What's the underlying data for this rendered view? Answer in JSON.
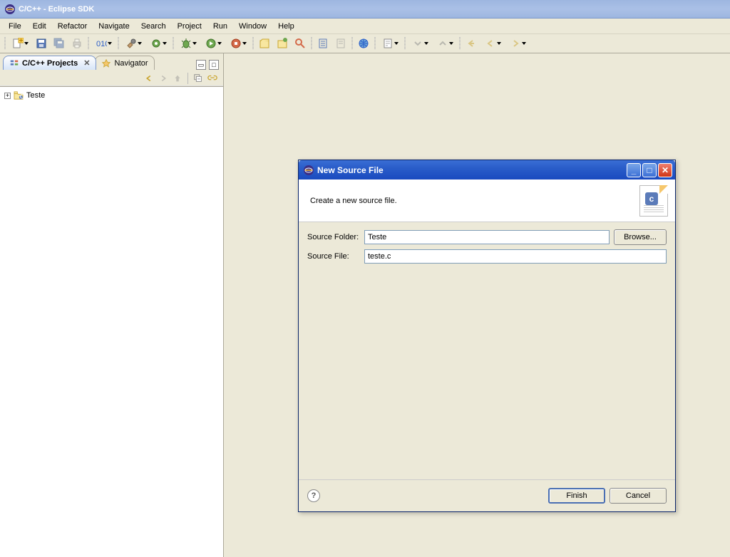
{
  "window": {
    "title": "C/C++ - Eclipse SDK"
  },
  "menu": {
    "file": "File",
    "edit": "Edit",
    "refactor": "Refactor",
    "navigate": "Navigate",
    "search": "Search",
    "project": "Project",
    "run": "Run",
    "window": "Window",
    "help": "Help"
  },
  "views": {
    "projects_tab": "C/C++ Projects",
    "navigator_tab": "Navigator",
    "tree_item_1": "Teste"
  },
  "dialog": {
    "title": "New Source File",
    "header_text": "Create a new source file.",
    "source_folder_label": "Source Folder:",
    "source_folder_value": "Teste",
    "source_file_label": "Source File:",
    "source_file_value": "teste.c",
    "browse": "Browse...",
    "finish": "Finish",
    "cancel": "Cancel",
    "help": "?",
    "c_letter": "c"
  }
}
